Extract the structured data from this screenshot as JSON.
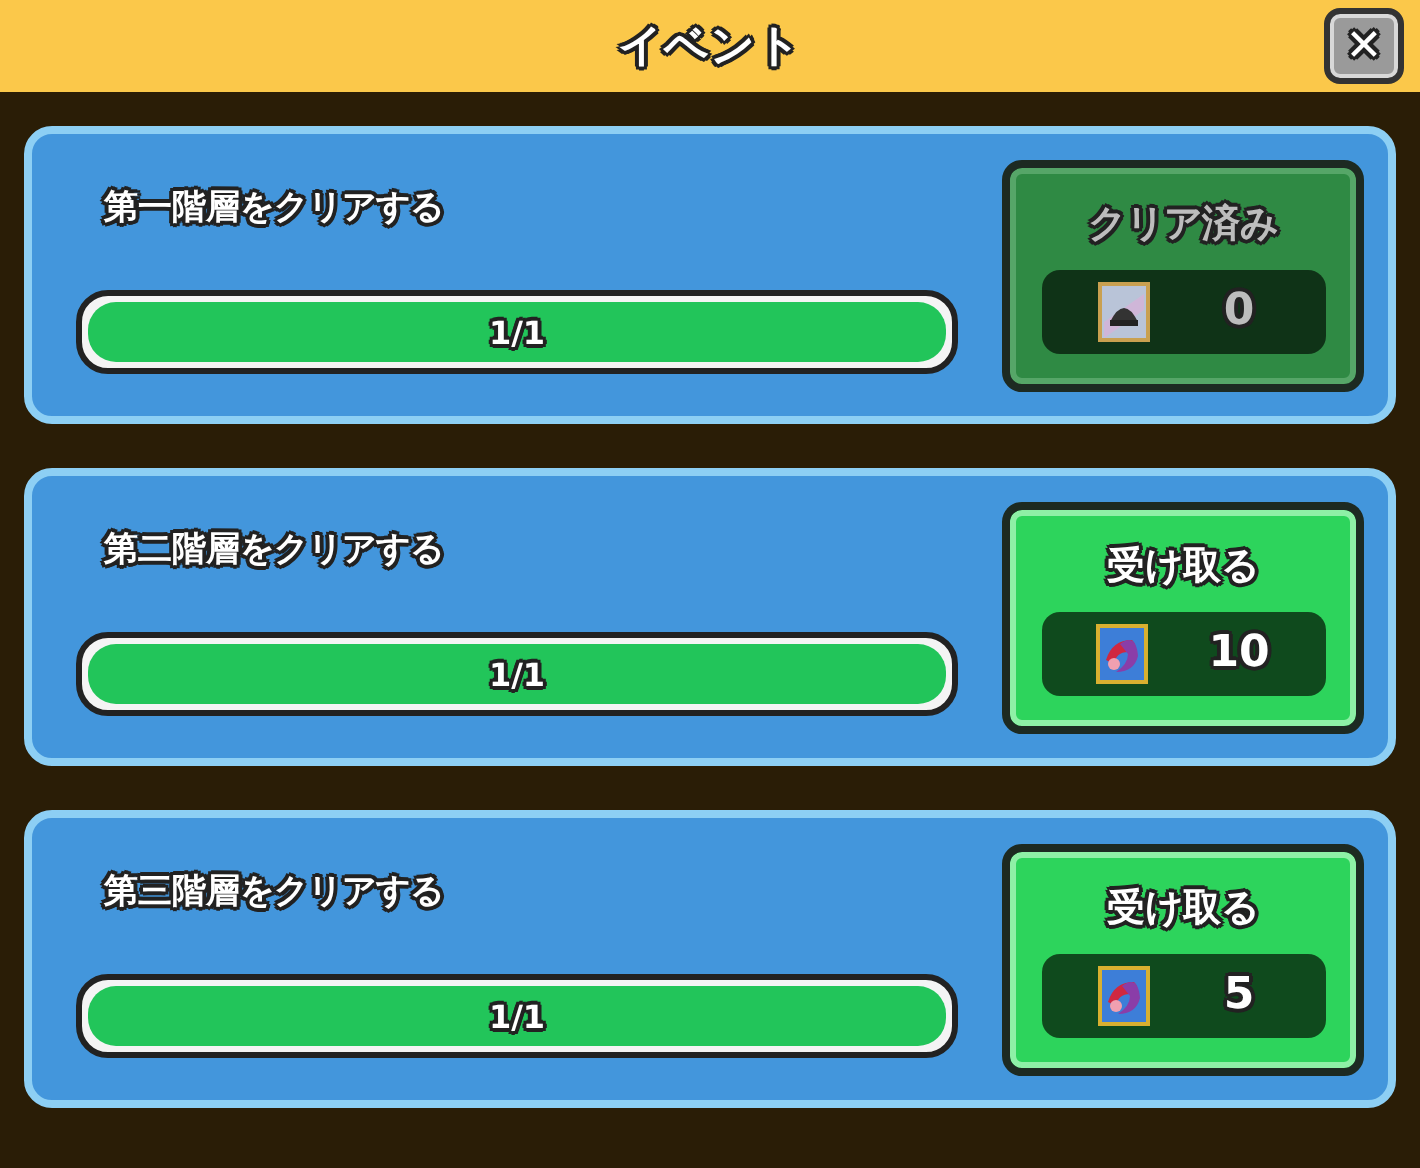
{
  "window": {
    "title": "イベント",
    "close": "✕"
  },
  "missions": [
    {
      "title": "第一階層をクリアする",
      "level": 1,
      "progress": "1/1",
      "claimed": true,
      "button": "クリア済み",
      "kind": "orb",
      "reward": "0"
    },
    {
      "title": "第二階層をクリアする",
      "level": 1,
      "progress": "1/1",
      "claimed": false,
      "button": "受け取る",
      "kind": "ribbon",
      "reward": "10"
    },
    {
      "title": "第三階層をクリアする",
      "level": 1,
      "progress": "1/1",
      "claimed": false,
      "button": "受け取る",
      "kind": "ribbon",
      "reward": "5"
    }
  ]
}
